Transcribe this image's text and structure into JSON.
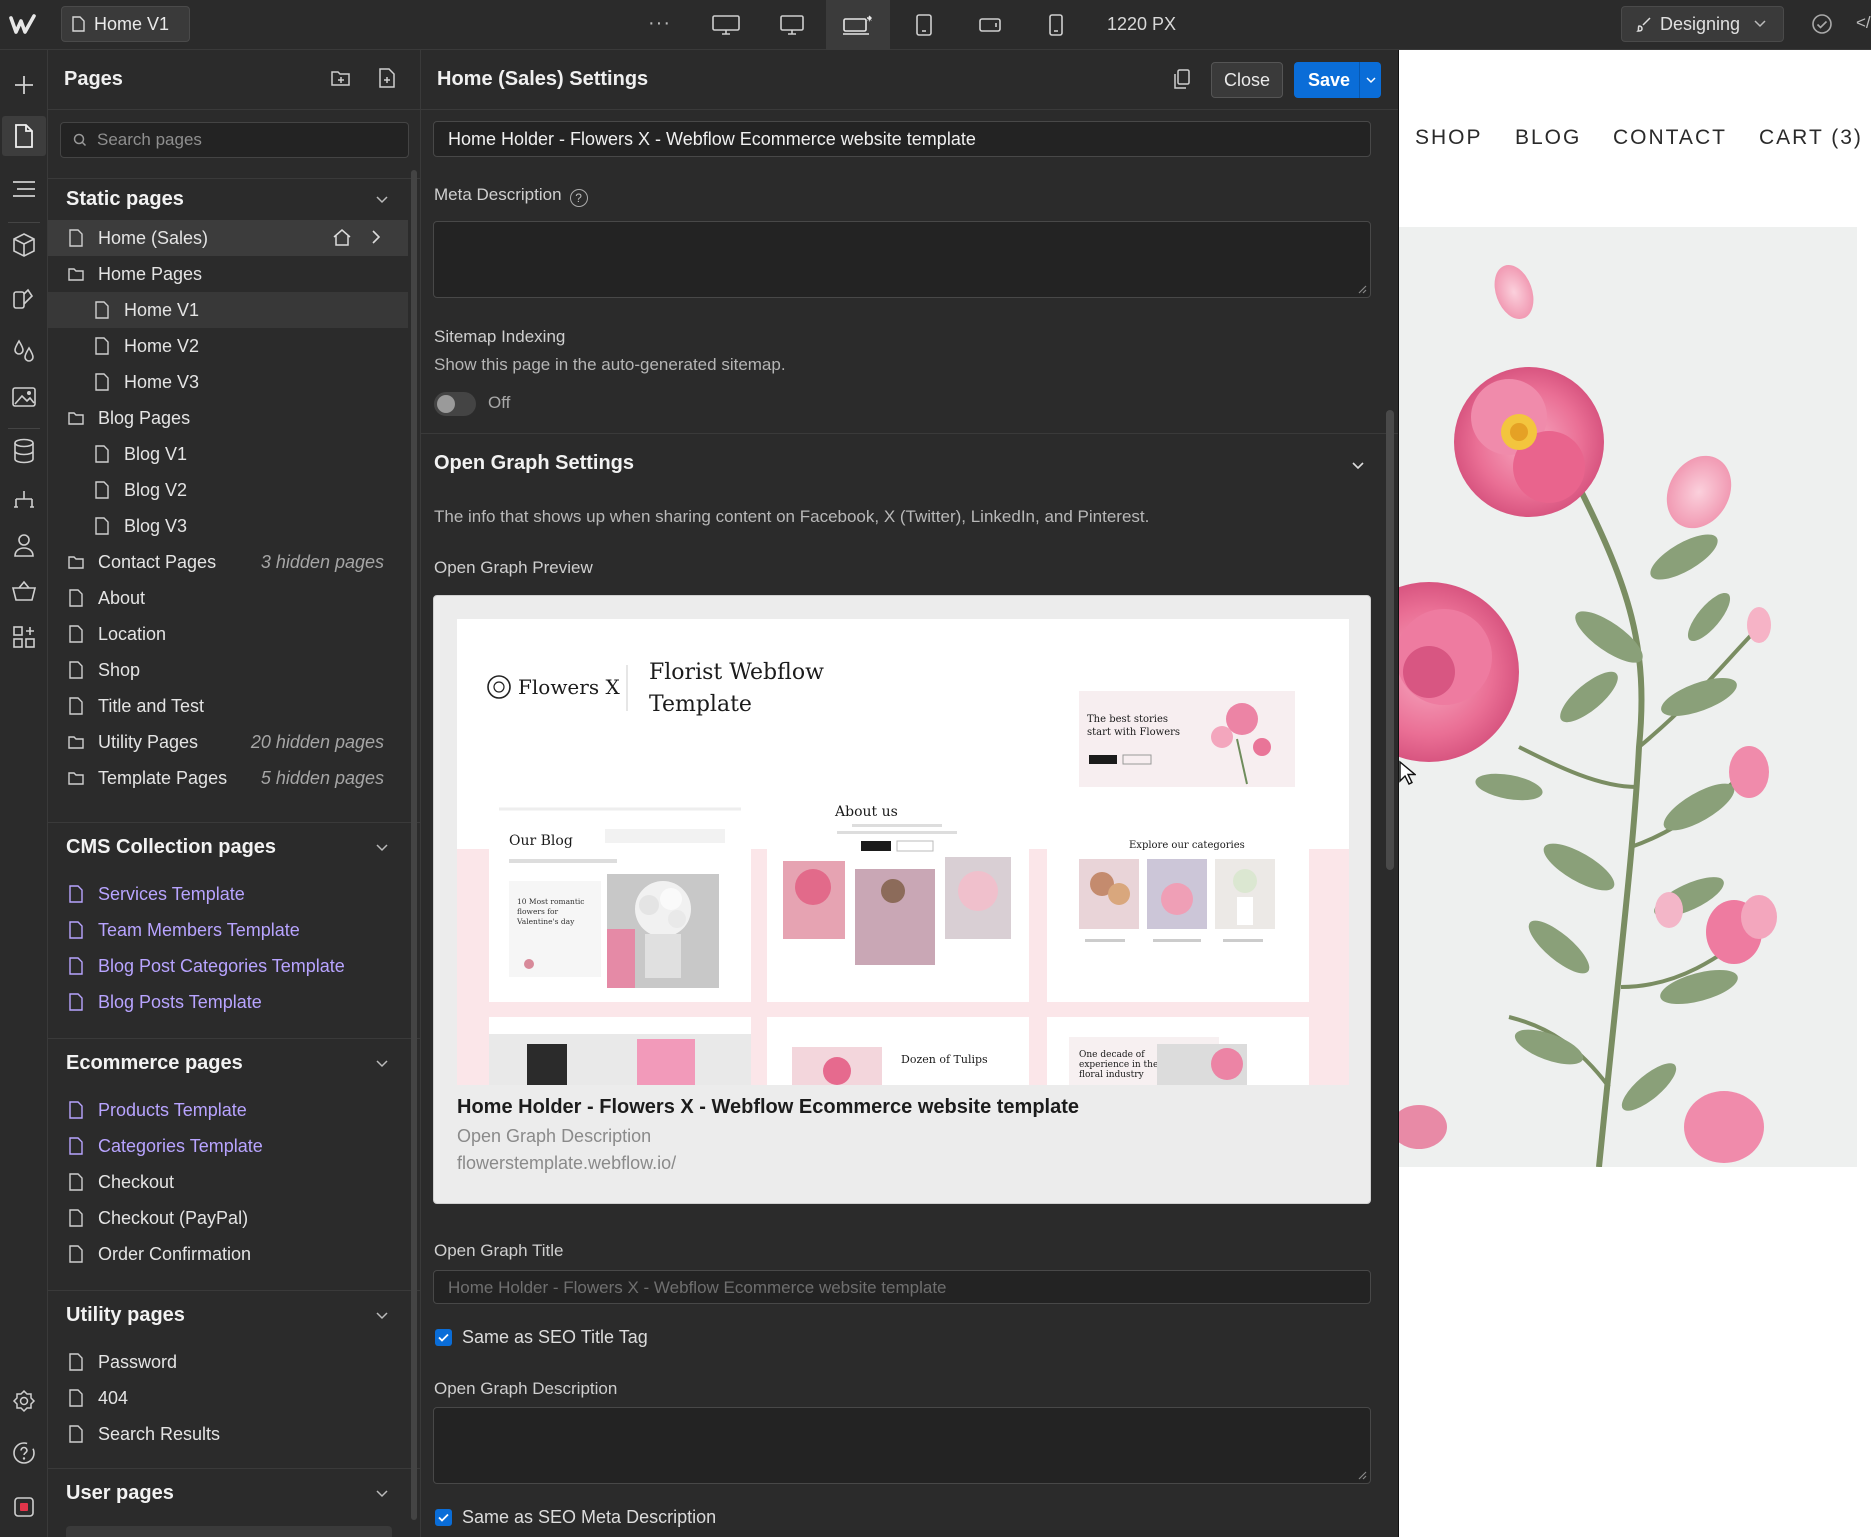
{
  "topbar": {
    "page_name": "Home V1",
    "more": "···",
    "width_readout": "1220 PX",
    "mode": "Designing",
    "breakpoints": [
      "desktop-large-icon",
      "desktop-icon",
      "desktop-base-icon",
      "tablet-icon",
      "mobile-landscape-icon",
      "mobile-portrait-icon"
    ],
    "active_breakpoint": 2
  },
  "pages_panel": {
    "title": "Pages",
    "search_placeholder": "Search pages",
    "static": {
      "title": "Static pages",
      "items": [
        {
          "label": "Home (Sales)",
          "type": "page",
          "level": 0,
          "selected": true,
          "home": true
        },
        {
          "label": "Home Pages",
          "type": "folder",
          "level": 0
        },
        {
          "label": "Home V1",
          "type": "page",
          "level": 1,
          "current": true
        },
        {
          "label": "Home V2",
          "type": "page",
          "level": 1
        },
        {
          "label": "Home V3",
          "type": "page",
          "level": 1
        },
        {
          "label": "Blog Pages",
          "type": "folder",
          "level": 0
        },
        {
          "label": "Blog V1",
          "type": "page",
          "level": 1
        },
        {
          "label": "Blog V2",
          "type": "page",
          "level": 1
        },
        {
          "label": "Blog V3",
          "type": "page",
          "level": 1
        },
        {
          "label": "Contact Pages",
          "type": "folder",
          "level": 0,
          "hidden": "3 hidden pages"
        },
        {
          "label": "About",
          "type": "page",
          "level": 0
        },
        {
          "label": "Location",
          "type": "page",
          "level": 0
        },
        {
          "label": "Shop",
          "type": "page",
          "level": 0
        },
        {
          "label": "Title and Test",
          "type": "page",
          "level": 0
        },
        {
          "label": "Utility Pages",
          "type": "folder",
          "level": 0,
          "hidden": "20 hidden pages"
        },
        {
          "label": "Template Pages",
          "type": "folder",
          "level": 0,
          "hidden": "5 hidden pages"
        }
      ]
    },
    "cms": {
      "title": "CMS Collection pages",
      "items": [
        "Services Template",
        "Team Members Template",
        "Blog Post Categories Template",
        "Blog Posts Template"
      ]
    },
    "ecommerce": {
      "title": "Ecommerce pages",
      "items": [
        {
          "label": "Products Template",
          "cms": true
        },
        {
          "label": "Categories Template",
          "cms": true
        },
        {
          "label": "Checkout",
          "cms": false
        },
        {
          "label": "Checkout (PayPal)",
          "cms": false
        },
        {
          "label": "Order Confirmation",
          "cms": false
        }
      ]
    },
    "utility": {
      "title": "Utility pages",
      "items": [
        "Password",
        "404",
        "Search Results"
      ]
    },
    "user": {
      "title": "User pages"
    }
  },
  "settings": {
    "title": "Home (Sales) Settings",
    "close": "Close",
    "save": "Save",
    "title_tag_value": "Home Holder - Flowers X - Webflow Ecommerce website template",
    "meta_description_label": "Meta Description",
    "help": "?",
    "sitemap_label": "Sitemap Indexing",
    "sitemap_help": "Show this page in the auto-generated sitemap.",
    "sitemap_state": "Off",
    "og_section_title": "Open Graph Settings",
    "og_intro": "The info that shows up when sharing content on Facebook, X (Twitter), LinkedIn, and Pinterest.",
    "og_preview_label": "Open Graph Preview",
    "preview": {
      "title": "Home Holder - Flowers X - Webflow Ecommerce website template",
      "description": "Open Graph Description",
      "url": "flowerstemplate.webflow.io/",
      "image": {
        "logo": "Flowers X",
        "heading_line1": "Florist Webflow",
        "heading_line2": "Template",
        "blog": "Our Blog",
        "about": "About us",
        "stories_line1": "The best stories",
        "stories_line2": "start with Flowers",
        "categories": "Explore our categories",
        "romantic": "10 Most romantic flowers for Valentine's day",
        "tulips": "Dozen of Tulips",
        "decade": "One decade of experience in the floral industry"
      }
    },
    "og_title_label": "Open Graph Title",
    "og_title_placeholder": "Home Holder - Flowers X - Webflow Ecommerce website template",
    "same_title": "Same as SEO Title Tag",
    "og_desc_label": "Open Graph Description",
    "same_desc": "Same as SEO Meta Description"
  },
  "canvas": {
    "nav": [
      "SHOP",
      "BLOG",
      "CONTACT",
      "CART (3)"
    ]
  }
}
